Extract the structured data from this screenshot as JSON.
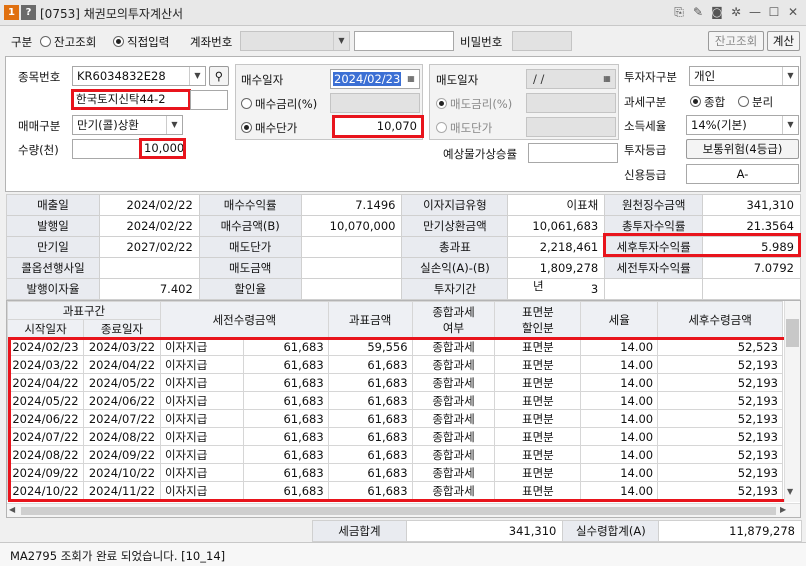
{
  "window": {
    "code": "[0753]",
    "title": "채권모의투자계산서",
    "icon_a": "1",
    "icon_b": "?"
  },
  "toolbar": {
    "type_label": "구분",
    "radio_balance": "잔고조회",
    "radio_direct": "직접입력",
    "account_label": "계좌번호",
    "password_label": "비밀번호",
    "balance_button": "잔고조회",
    "calc_button": "계산"
  },
  "form": {
    "item_code_label": "종목번호",
    "item_code": "KR6034832E28",
    "item_name": "한국토지신탁44-2",
    "trade_type_label": "매매구분",
    "trade_type": "만기(콜)상환",
    "qty_label": "수량(천)",
    "qty": "10,000",
    "buy_date_label": "매수일자",
    "buy_date": "2024/02/23",
    "buy_rate_label": "매수금리(%)",
    "buy_price_label": "매수단가",
    "buy_price": "10,070",
    "sell_date_label": "매도일자",
    "sell_date": " / /",
    "sell_rate_label": "매도금리(%)",
    "sell_price_label": "매도단가",
    "exp_yield_label": "예상물가상승률",
    "investor_label": "투자자구분",
    "investor": "개인",
    "tax_type_label": "과세구분",
    "tax_combined": "종합",
    "tax_separate": "분리",
    "income_tax_label": "소득세율",
    "income_tax": "14%(기본)",
    "invest_grade_label": "투자등급",
    "invest_grade": "보통위험(4등급)",
    "credit_label": "신용등급",
    "credit": "A-"
  },
  "summary": [
    [
      {
        "k": "매출일",
        "v": "2024/02/22"
      },
      {
        "k": "매수수익률",
        "v": "7.1496"
      },
      {
        "k": "이자지급유형",
        "v": "이표채"
      },
      {
        "k": "원천징수금액",
        "v": "341,310"
      }
    ],
    [
      {
        "k": "발행일",
        "v": "2024/02/22"
      },
      {
        "k": "매수금액(B)",
        "v": "10,070,000"
      },
      {
        "k": "만기상환금액",
        "v": "10,061,683"
      },
      {
        "k": "총투자수익률",
        "v": "21.3564"
      }
    ],
    [
      {
        "k": "만기일",
        "v": "2027/02/22"
      },
      {
        "k": "매도단가",
        "v": ""
      },
      {
        "k": "총과표",
        "v": "2,218,461"
      },
      {
        "k": "세후투자수익률",
        "v": "5.989"
      }
    ],
    [
      {
        "k": "콜옵션행사일",
        "v": ""
      },
      {
        "k": "매도금액",
        "v": ""
      },
      {
        "k": "실손익(A)-(B)",
        "v": "1,809,278"
      },
      {
        "k": "세전투자수익률",
        "v": "7.0792"
      }
    ],
    [
      {
        "k": "발행이자율",
        "v": "7.402"
      },
      {
        "k": "할인율",
        "v": ""
      },
      {
        "k": "투자기간",
        "v": "3"
      },
      {
        "k": "",
        "v": ""
      }
    ]
  ],
  "invest_period_unit": "년",
  "grid": {
    "h_period": "과표구간",
    "h_start": "시작일자",
    "h_end": "종료일자",
    "h_pretax": "세전수령금액",
    "h_taxbase": "과표금액",
    "h_combined_1": "종합과세",
    "h_combined_2": "여부",
    "h_face_1": "표면분",
    "h_face_2": "할인분",
    "h_rate": "세율",
    "h_aftertax": "세후수령금액",
    "rows": [
      [
        "2024/02/23",
        "2024/03/22",
        "이자지급",
        "61,683",
        "59,556",
        "종합과세",
        "표면분",
        "14.00",
        "52,523"
      ],
      [
        "2024/03/22",
        "2024/04/22",
        "이자지급",
        "61,683",
        "61,683",
        "종합과세",
        "표면분",
        "14.00",
        "52,193"
      ],
      [
        "2024/04/22",
        "2024/05/22",
        "이자지급",
        "61,683",
        "61,683",
        "종합과세",
        "표면분",
        "14.00",
        "52,193"
      ],
      [
        "2024/05/22",
        "2024/06/22",
        "이자지급",
        "61,683",
        "61,683",
        "종합과세",
        "표면분",
        "14.00",
        "52,193"
      ],
      [
        "2024/06/22",
        "2024/07/22",
        "이자지급",
        "61,683",
        "61,683",
        "종합과세",
        "표면분",
        "14.00",
        "52,193"
      ],
      [
        "2024/07/22",
        "2024/08/22",
        "이자지급",
        "61,683",
        "61,683",
        "종합과세",
        "표면분",
        "14.00",
        "52,193"
      ],
      [
        "2024/08/22",
        "2024/09/22",
        "이자지급",
        "61,683",
        "61,683",
        "종합과세",
        "표면분",
        "14.00",
        "52,193"
      ],
      [
        "2024/09/22",
        "2024/10/22",
        "이자지급",
        "61,683",
        "61,683",
        "종합과세",
        "표면분",
        "14.00",
        "52,193"
      ],
      [
        "2024/10/22",
        "2024/11/22",
        "이자지급",
        "61,683",
        "61,683",
        "종합과세",
        "표면분",
        "14.00",
        "52,193"
      ]
    ]
  },
  "totals": {
    "tax_label": "세금합계",
    "tax": "341,310",
    "recv_label": "실수령합계(A)",
    "recv": "11,879,278"
  },
  "status": "MA2795 조회가 완료 되었습니다. [10_14]"
}
